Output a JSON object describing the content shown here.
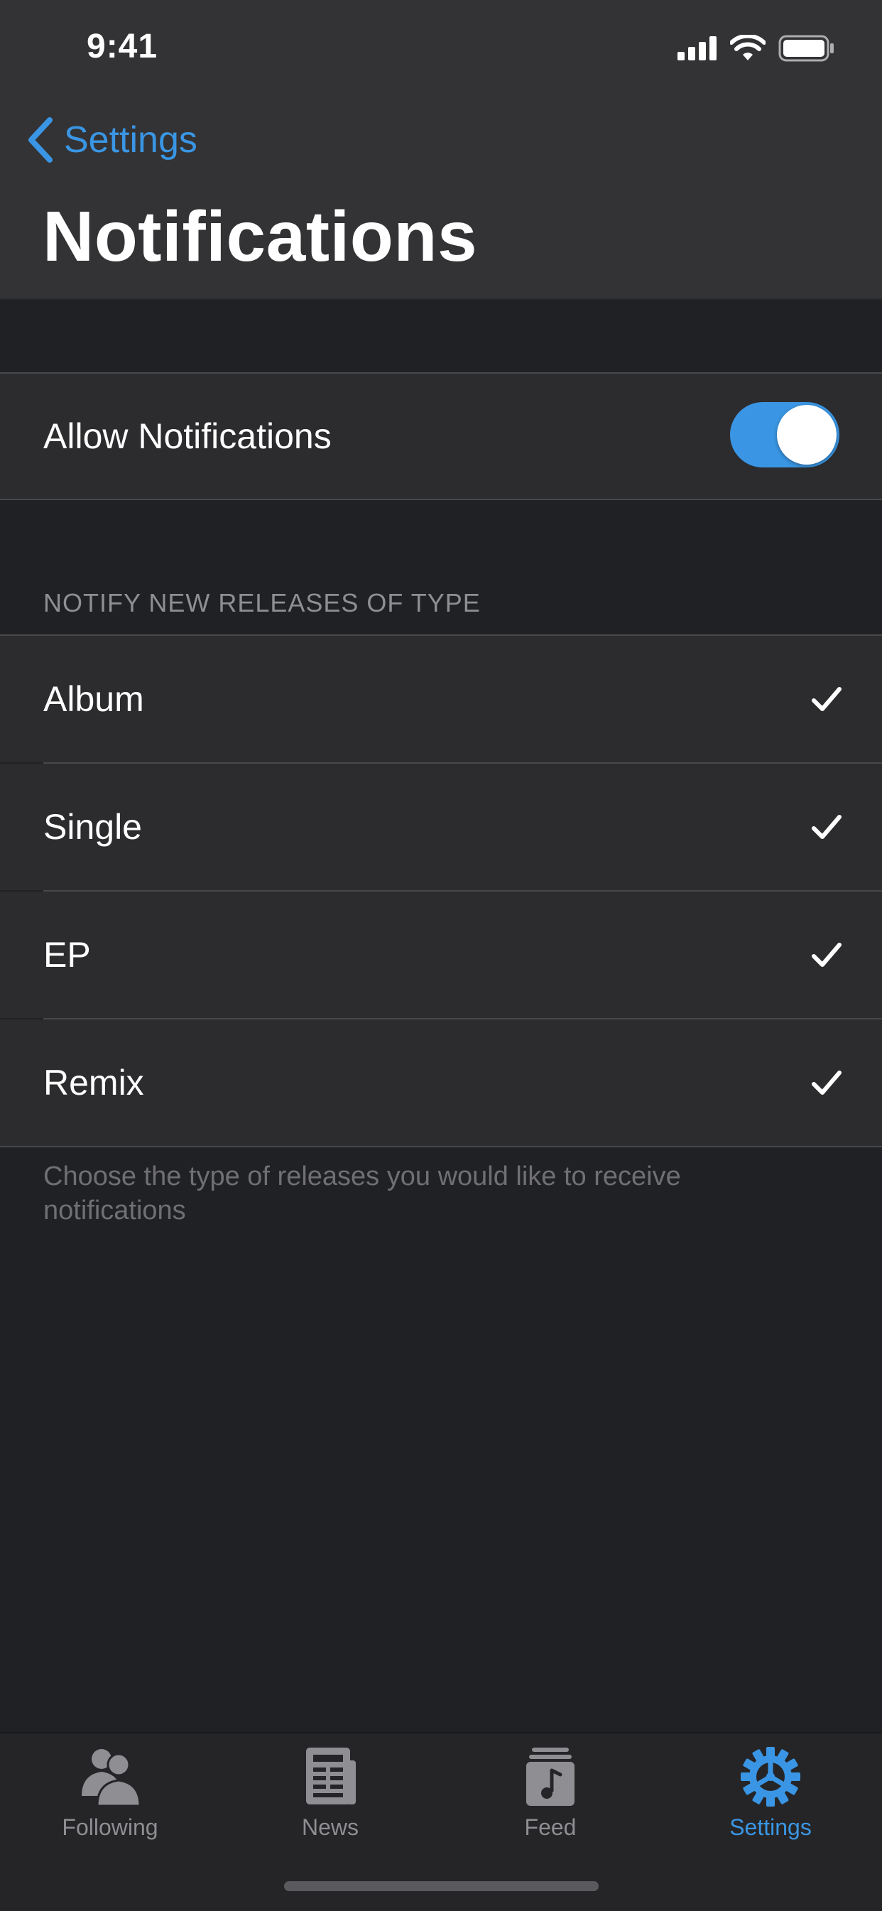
{
  "status_bar": {
    "time": "9:41"
  },
  "nav": {
    "back_label": "Settings",
    "title": "Notifications"
  },
  "allow": {
    "label": "Allow Notifications",
    "enabled": true
  },
  "release_types": {
    "header": "NOTIFY NEW RELEASES OF TYPE",
    "items": [
      {
        "label": "Album",
        "checked": true
      },
      {
        "label": "Single",
        "checked": true
      },
      {
        "label": "EP",
        "checked": true
      },
      {
        "label": "Remix",
        "checked": true
      }
    ],
    "footer": "Choose the type of releases you would like to receive notifications"
  },
  "tabbar": {
    "tabs": [
      {
        "label": "Following",
        "icon": "people-icon",
        "active": false
      },
      {
        "label": "News",
        "icon": "newspaper-icon",
        "active": false
      },
      {
        "label": "Feed",
        "icon": "music-stack-icon",
        "active": false
      },
      {
        "label": "Settings",
        "icon": "gear-icon",
        "active": true
      }
    ]
  },
  "colors": {
    "accent": "#3a96e4",
    "background": "#202124",
    "cell": "#2c2c2e",
    "header": "#333335"
  }
}
